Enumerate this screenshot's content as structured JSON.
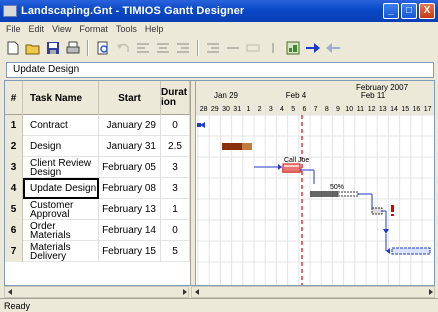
{
  "window": {
    "title": "Landscaping.Gnt - TIMIOS Gantt Designer",
    "minimize": "_",
    "maximize": "□",
    "close": "X"
  },
  "menu": [
    "File",
    "Edit",
    "View",
    "Format",
    "Tools",
    "Help"
  ],
  "toolbar": {
    "icons": [
      "new-icon",
      "open-icon",
      "save-icon",
      "print-icon",
      "preview-icon",
      "undo-icon",
      "align-left-icon",
      "align-center-icon",
      "align-right-icon",
      "indent-icon",
      "outdent-icon",
      "link-icon",
      "split-icon",
      "image-icon",
      "forward-arrow-icon",
      "back-arrow-icon"
    ]
  },
  "edit_field": {
    "value": "Update Design"
  },
  "table": {
    "headers": {
      "num": "#",
      "name": "Task Name",
      "start": "Start",
      "duration": "Duration"
    },
    "rows": [
      {
        "num": "1",
        "name": "Contract",
        "start": "January 29",
        "duration": "0"
      },
      {
        "num": "2",
        "name": "Design",
        "start": "January 31",
        "duration": "2.5"
      },
      {
        "num": "3",
        "name": "Client Review Design",
        "start": "February 05",
        "duration": "3"
      },
      {
        "num": "4",
        "name": "Update Design",
        "start": "February 08",
        "duration": "3"
      },
      {
        "num": "5",
        "name": "Customer Approval",
        "start": "February 13",
        "duration": "1"
      },
      {
        "num": "6",
        "name": "Order Materials",
        "start": "February 14",
        "duration": "0"
      },
      {
        "num": "7",
        "name": "Materials Delivery",
        "start": "February 15",
        "duration": "5"
      }
    ]
  },
  "gantt": {
    "month_label": "February 2007",
    "week_labels": [
      "Jan 29",
      "Feb 4",
      "Feb 11"
    ],
    "day_labels": [
      "28",
      "29",
      "30",
      "31",
      "1",
      "2",
      "3",
      "4",
      "5",
      "6",
      "7",
      "8",
      "9",
      "10",
      "11",
      "12",
      "13",
      "14",
      "15",
      "16",
      "17"
    ],
    "annotations": {
      "call_note": "Call Joe",
      "percent": "50%"
    },
    "colors": {
      "bar_blue": "#1f3cc8",
      "bar_brown": "#8b2e0b",
      "today_line": "#e00000",
      "milestone": "#1f3cc8",
      "hatched": "#222222"
    }
  },
  "status": {
    "text": "Ready"
  }
}
